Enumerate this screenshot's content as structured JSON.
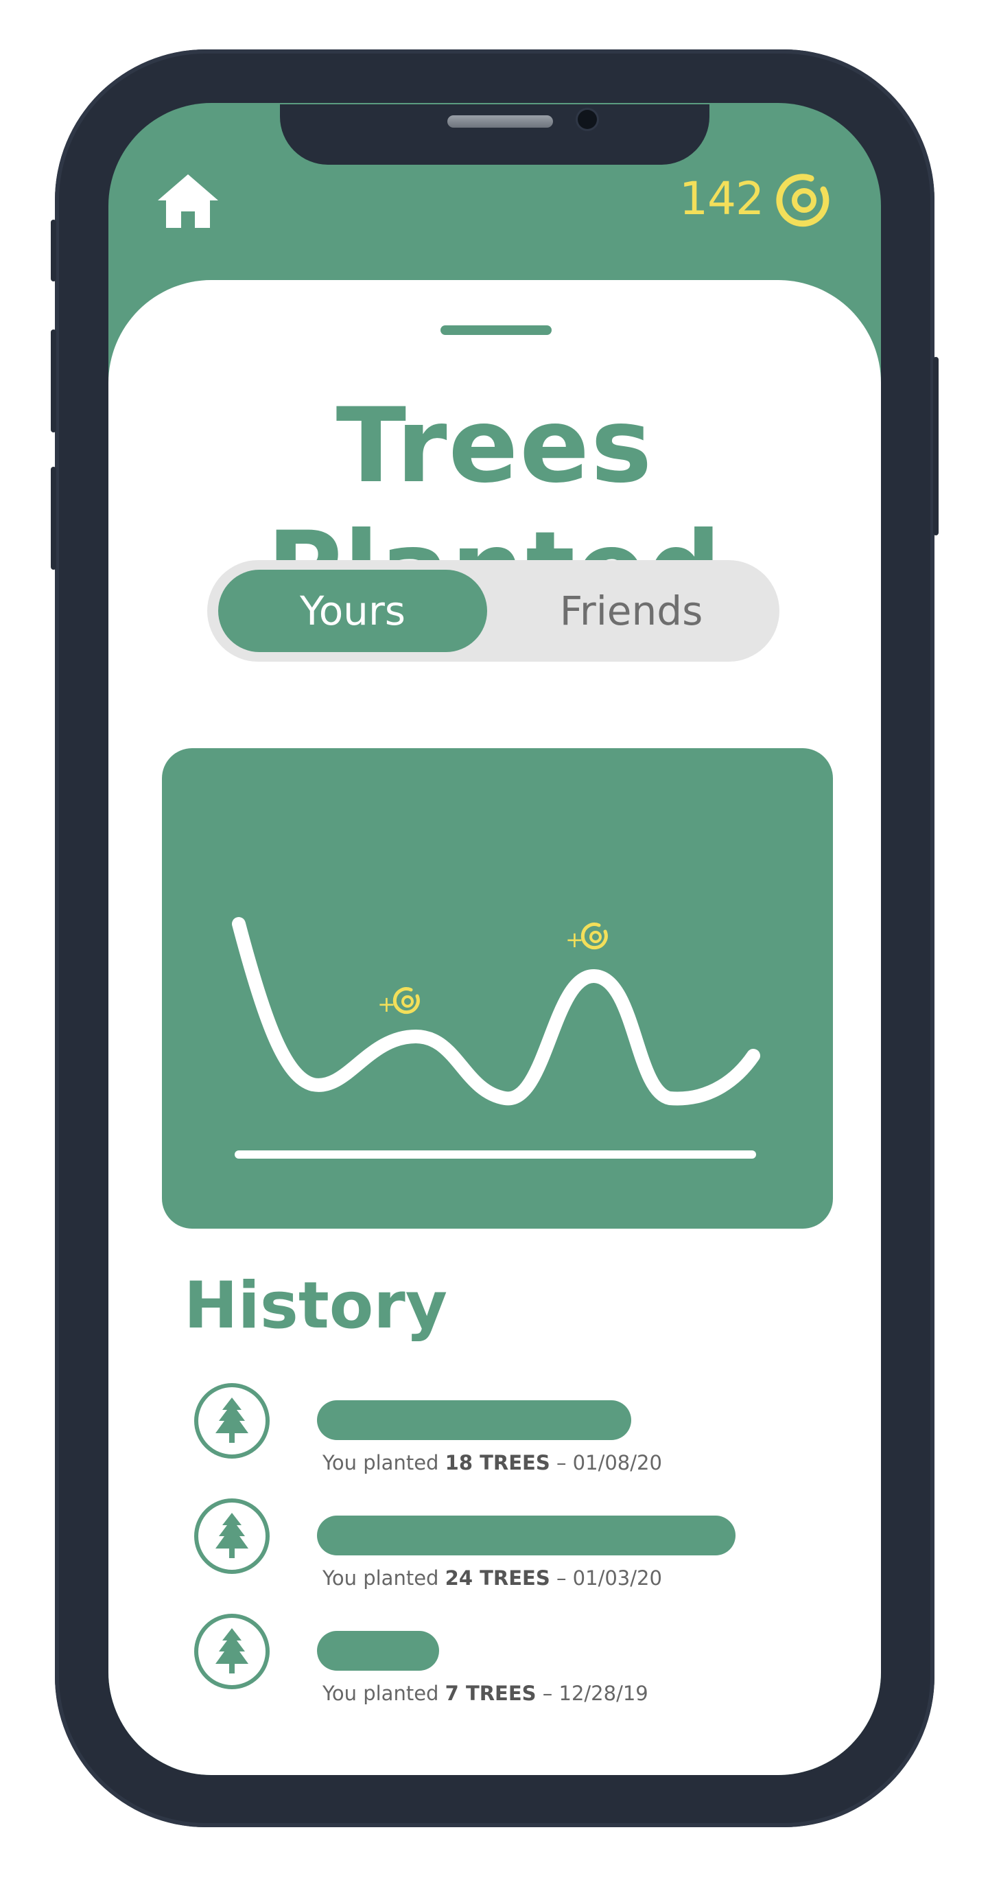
{
  "header": {
    "home_icon": "home-icon",
    "points": "142",
    "points_icon": "coin-icon"
  },
  "page": {
    "title": "Trees Planted"
  },
  "toggle": {
    "selected": "Yours",
    "options": [
      "Yours",
      "Friends"
    ]
  },
  "chart": {
    "markers": [
      {
        "label": "+",
        "icon": "coin-icon"
      },
      {
        "label": "+",
        "icon": "coin-icon"
      }
    ]
  },
  "history": {
    "title": "History",
    "items": [
      {
        "icon": "tree-icon",
        "prefix": "You planted ",
        "amount": "18 TREES",
        "suffix": " – 01/08/20",
        "trees": 18
      },
      {
        "icon": "tree-icon",
        "prefix": "You planted ",
        "amount": "24 TREES",
        "suffix": " – 01/03/20",
        "trees": 24
      },
      {
        "icon": "tree-icon",
        "prefix": "You planted ",
        "amount": "7 TREES",
        "suffix": " – 12/28/19",
        "trees": 7
      }
    ]
  },
  "colors": {
    "brand_green": "#5b9c80",
    "coin_yellow": "#f3df5a",
    "phone_frame": "#262d3a",
    "toggle_bg": "#e5e5e5"
  }
}
